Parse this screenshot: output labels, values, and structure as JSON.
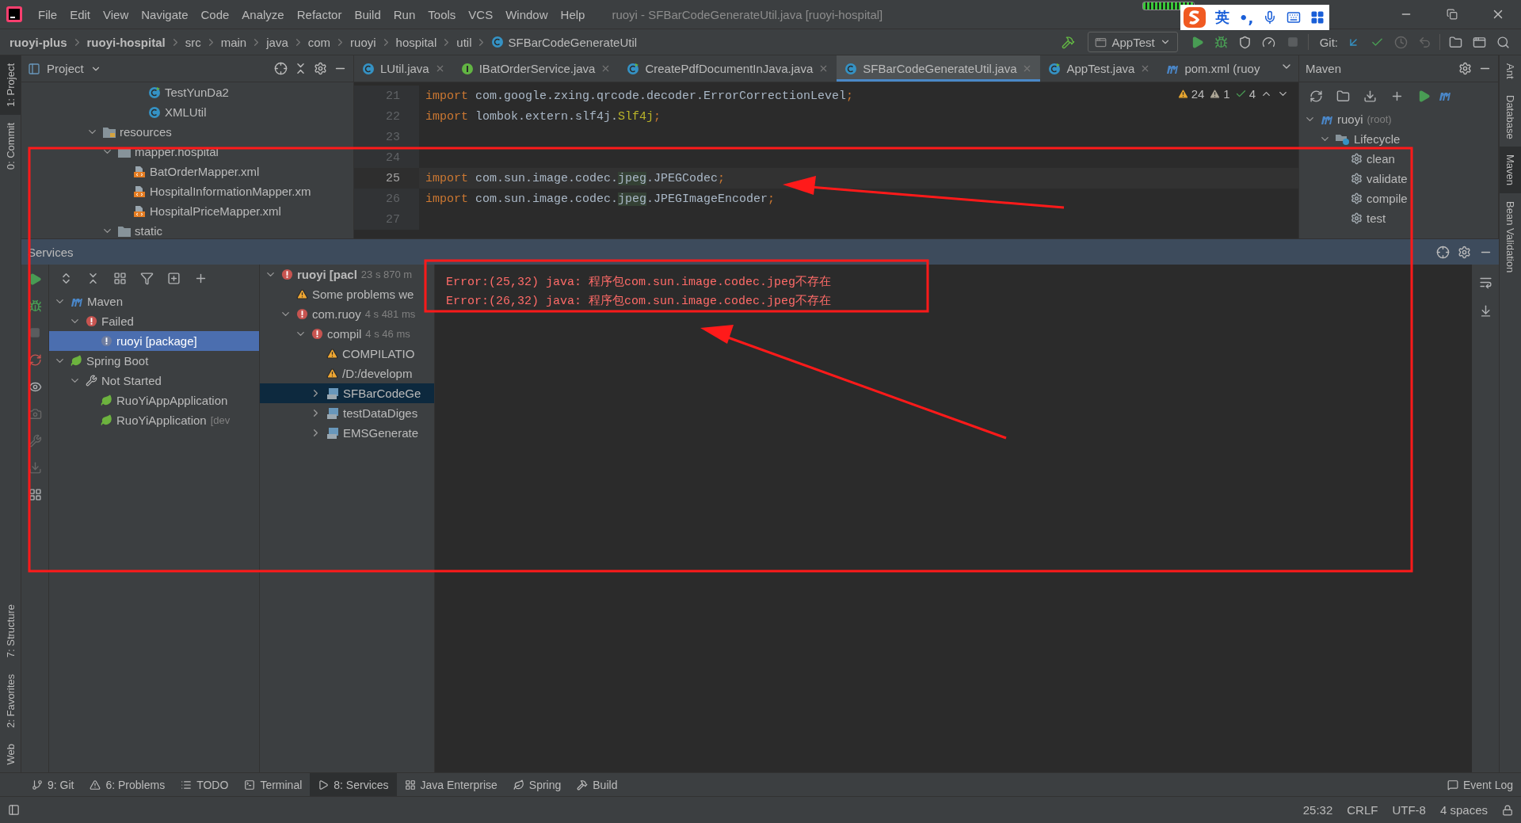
{
  "title_bar": {
    "menu": [
      "File",
      "Edit",
      "View",
      "Navigate",
      "Code",
      "Analyze",
      "Refactor",
      "Build",
      "Run",
      "Tools",
      "VCS",
      "Window",
      "Help"
    ],
    "title": "ruoyi - SFBarCodeGenerateUtil.java [ruoyi-hospital]"
  },
  "ime_toolbar": {
    "language": "英",
    "punctuation": "•,"
  },
  "navigation_bar": {
    "breadcrumbs": [
      {
        "label": "ruoyi-plus",
        "kind": "module"
      },
      {
        "label": "ruoyi-hospital",
        "kind": "module"
      },
      {
        "label": "src",
        "kind": "folder"
      },
      {
        "label": "main",
        "kind": "folder"
      },
      {
        "label": "java",
        "kind": "folder"
      },
      {
        "label": "com",
        "kind": "folder"
      },
      {
        "label": "ruoyi",
        "kind": "folder"
      },
      {
        "label": "hospital",
        "kind": "folder"
      },
      {
        "label": "util",
        "kind": "folder"
      },
      {
        "label": "SFBarCodeGenerateUtil",
        "kind": "class"
      }
    ],
    "run_config": "AppTest",
    "git_label": "Git:"
  },
  "left_tool_strip": {
    "top": [
      {
        "label": "1: Project",
        "selected": true
      },
      {
        "label": "0: Commit",
        "selected": false
      }
    ],
    "bottom": [
      {
        "label": "7: Structure",
        "selected": false
      },
      {
        "label": "2: Favorites",
        "selected": false
      },
      {
        "label": "Web",
        "selected": false
      }
    ]
  },
  "project_panel": {
    "title": "Project",
    "tree": [
      {
        "label": "TestYunDa2",
        "kind": "test-class"
      },
      {
        "label": "XMLUtil",
        "kind": "class"
      },
      {
        "label": "resources",
        "kind": "resource-folder",
        "expanded": true,
        "children": [
          {
            "label": "mapper.hospital",
            "kind": "folder",
            "expanded": true,
            "children": [
              {
                "label": "BatOrderMapper.xml",
                "kind": "xml"
              },
              {
                "label": "HospitalInformationMapper.xm",
                "kind": "xml"
              },
              {
                "label": "HospitalPriceMapper.xml",
                "kind": "xml"
              }
            ]
          },
          {
            "label": "static",
            "kind": "folder",
            "expanded": true
          }
        ]
      }
    ]
  },
  "editor": {
    "tabs": [
      {
        "label": "LUtil.java",
        "kind": "class",
        "selected": false
      },
      {
        "label": "IBatOrderService.java",
        "kind": "interface",
        "selected": false
      },
      {
        "label": "CreatePdfDocumentInJava.java",
        "kind": "test-class",
        "selected": false
      },
      {
        "label": "SFBarCodeGenerateUtil.java",
        "kind": "class",
        "selected": true
      },
      {
        "label": "AppTest.java",
        "kind": "test-class",
        "selected": false
      },
      {
        "label": "pom.xml (ruoy",
        "kind": "maven",
        "selected": false
      }
    ],
    "inspections": {
      "warnings": "24",
      "weak_warnings": "1",
      "typos": "4"
    },
    "lines": [
      {
        "number": "21",
        "current": false,
        "segments": [
          {
            "text": "import",
            "kind": "keyword"
          },
          {
            "text": " com.google.zxing.qrcode.decoder.ErrorCorrectionLevel",
            "kind": "plain"
          },
          {
            "text": ";",
            "kind": "keyword"
          }
        ]
      },
      {
        "number": "22",
        "current": false,
        "segments": [
          {
            "text": "import",
            "kind": "keyword"
          },
          {
            "text": " lombok.extern.slf4j.",
            "kind": "plain"
          },
          {
            "text": "Slf4j",
            "kind": "annotation"
          },
          {
            "text": ";",
            "kind": "keyword"
          }
        ]
      },
      {
        "number": "23",
        "current": false
      },
      {
        "number": "24",
        "current": false
      },
      {
        "number": "25",
        "current": true,
        "segments": [
          {
            "text": "import",
            "kind": "keyword"
          },
          {
            "text": " com.sun.image.codec.",
            "kind": "plain"
          },
          {
            "text": "jpeg",
            "kind": "match"
          },
          {
            "text": ".JPEGCodec",
            "kind": "plain"
          },
          {
            "text": ";",
            "kind": "keyword"
          }
        ]
      },
      {
        "number": "26",
        "current": false,
        "segments": [
          {
            "text": "import",
            "kind": "keyword"
          },
          {
            "text": " com.sun.image.codec.",
            "kind": "plain"
          },
          {
            "text": "jpeg",
            "kind": "match"
          },
          {
            "text": ".JPEGImageEncoder",
            "kind": "plain"
          },
          {
            "text": ";",
            "kind": "keyword"
          }
        ]
      },
      {
        "number": "27",
        "current": false
      }
    ]
  },
  "maven_panel": {
    "title": "Maven",
    "tree": [
      {
        "label": "ruoyi",
        "suffix": "(root)",
        "kind": "module",
        "expanded": true,
        "children": [
          {
            "label": "Lifecycle",
            "kind": "lifecycle",
            "expanded": true,
            "children": [
              {
                "label": "clean",
                "kind": "goal"
              },
              {
                "label": "validate",
                "kind": "goal"
              },
              {
                "label": "compile",
                "kind": "goal"
              },
              {
                "label": "test",
                "kind": "goal"
              }
            ]
          }
        ]
      }
    ]
  },
  "right_tool_strip": [
    {
      "label": "Ant",
      "selected": false
    },
    {
      "label": "Database",
      "selected": false
    },
    {
      "label": "Maven",
      "selected": true
    },
    {
      "label": "Bean Validation",
      "selected": false
    }
  ],
  "services": {
    "title": "Services",
    "tree": [
      {
        "label": "Maven",
        "kind": "maven",
        "expanded": true,
        "selected": false,
        "children": [
          {
            "label": "Failed",
            "kind": "error",
            "expanded": true,
            "selected": false,
            "children": [
              {
                "label": "ruoyi [package]",
                "kind": "error-muted",
                "selected": true
              }
            ]
          }
        ]
      },
      {
        "label": "Spring Boot",
        "kind": "spring",
        "expanded": true,
        "selected": false,
        "children": [
          {
            "label": "Not Started",
            "kind": "wrench",
            "expanded": true,
            "selected": false,
            "children": [
              {
                "label": "RuoYiAppApplication",
                "kind": "spring",
                "selected": false
              },
              {
                "label": "RuoYiApplication",
                "suffix": "[dev",
                "kind": "spring",
                "selected": false
              }
            ]
          }
        ]
      }
    ],
    "run_tree": [
      {
        "label": "ruoyi [pacl",
        "suffix": "23 s 870 m",
        "kind": "error",
        "expanded": true,
        "selected": false,
        "children": [
          {
            "label": "Some problems we",
            "kind": "warning",
            "selected": false
          },
          {
            "label": "com.ruoy",
            "suffix": "4 s 481 ms",
            "kind": "error",
            "expanded": true,
            "selected": false,
            "children": [
              {
                "label": "compil",
                "suffix": "4 s 46 ms",
                "kind": "error",
                "expanded": true,
                "selected": false,
                "children": [
                  {
                    "label": "COMPILATIO",
                    "kind": "warning",
                    "selected": false
                  },
                  {
                    "label": "/D:/developm",
                    "kind": "warning",
                    "selected": false
                  },
                  {
                    "label": "SFBarCodeGe",
                    "kind": "build-class",
                    "expanded": false,
                    "selected": true
                  },
                  {
                    "label": "testDataDiges",
                    "kind": "build-class",
                    "expanded": false,
                    "selected": false
                  },
                  {
                    "label": "EMSGenerate",
                    "kind": "build-class",
                    "expanded": false,
                    "selected": false
                  }
                ]
              }
            ]
          }
        ]
      }
    ],
    "console": [
      "Error:(25,32) java: 程序包com.sun.image.codec.jpeg不存在",
      "Error:(26,32) java: 程序包com.sun.image.codec.jpeg不存在"
    ]
  },
  "bottom_tabs": [
    {
      "label": "9: Git",
      "kind": "git",
      "selected": false
    },
    {
      "label": "6: Problems",
      "kind": "problems",
      "selected": false
    },
    {
      "label": "TODO",
      "kind": "todo",
      "selected": false
    },
    {
      "label": "Terminal",
      "kind": "terminal",
      "selected": false
    },
    {
      "label": "8: Services",
      "kind": "services",
      "selected": true
    },
    {
      "label": "Java Enterprise",
      "kind": "enterprise",
      "selected": false
    },
    {
      "label": "Spring",
      "kind": "spring",
      "selected": false
    },
    {
      "label": "Build",
      "kind": "build",
      "selected": false
    }
  ],
  "event_log": "Event Log",
  "status_bar": [
    "25:32",
    "CRLF",
    "UTF-8",
    "4 spaces"
  ]
}
